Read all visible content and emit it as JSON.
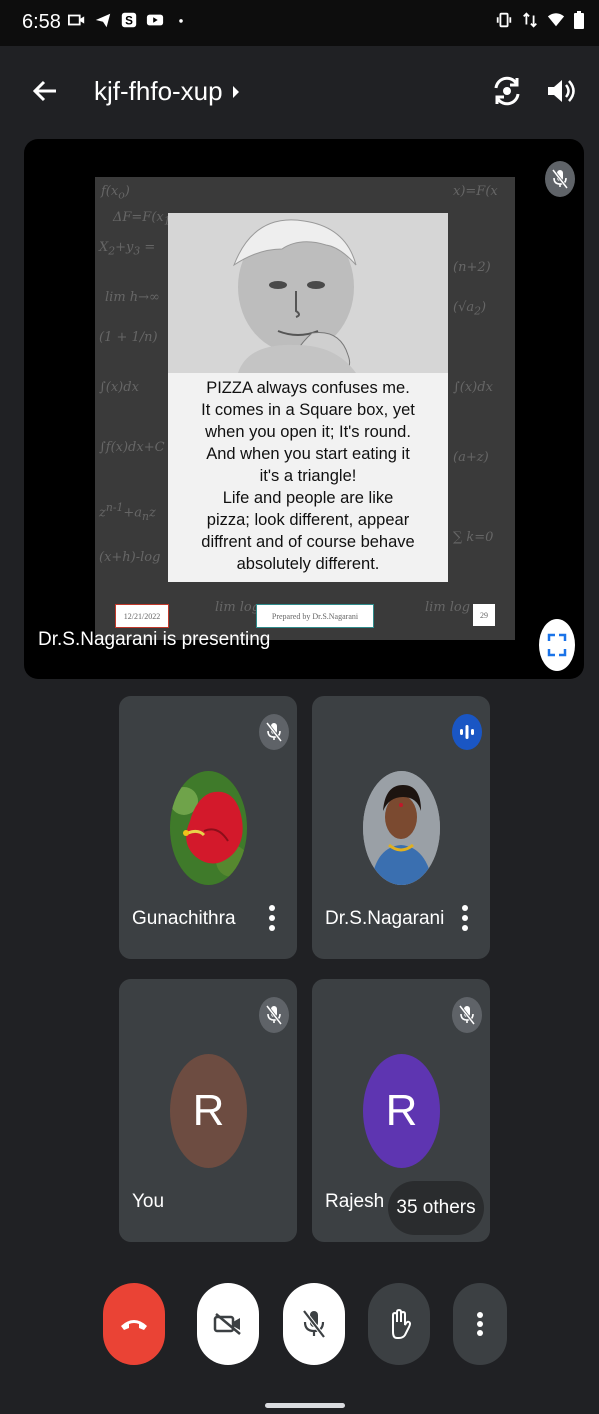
{
  "status_bar": {
    "time": "6:58"
  },
  "appbar": {
    "meeting_code": "kjf-fhfo-xup"
  },
  "presentation": {
    "quote_lines": [
      "PIZZA always confuses me.",
      "It comes in a Square box, yet",
      "when you open it; It's round.",
      "And when you start eating it",
      "it's a triangle!",
      "Life and people are like",
      "pizza; look different, appear",
      "diffrent and of course behave",
      "absolutely different."
    ],
    "footer_date": "12/21/2022",
    "footer_author": "Prepared by  Dr.S.Nagarani",
    "footer_page": "29",
    "presenting_label": "Dr.S.Nagarani is presenting"
  },
  "participants": [
    {
      "name": "Gunachithra",
      "avatar_letter": "",
      "avatar_color": "#c0182a"
    },
    {
      "name": "Dr.S.Nagarani",
      "avatar_letter": "",
      "avatar_color": "#8a8f96"
    },
    {
      "name": "You",
      "avatar_letter": "R",
      "avatar_color": "#6d4c41"
    },
    {
      "name": "Rajesh",
      "avatar_letter": "R",
      "avatar_color": "#5e35b1"
    }
  ],
  "others_label": "35 others",
  "colors": {
    "end_call": "#ea4335",
    "speaking": "#1a73e8",
    "tile_bg": "#3c4043"
  }
}
